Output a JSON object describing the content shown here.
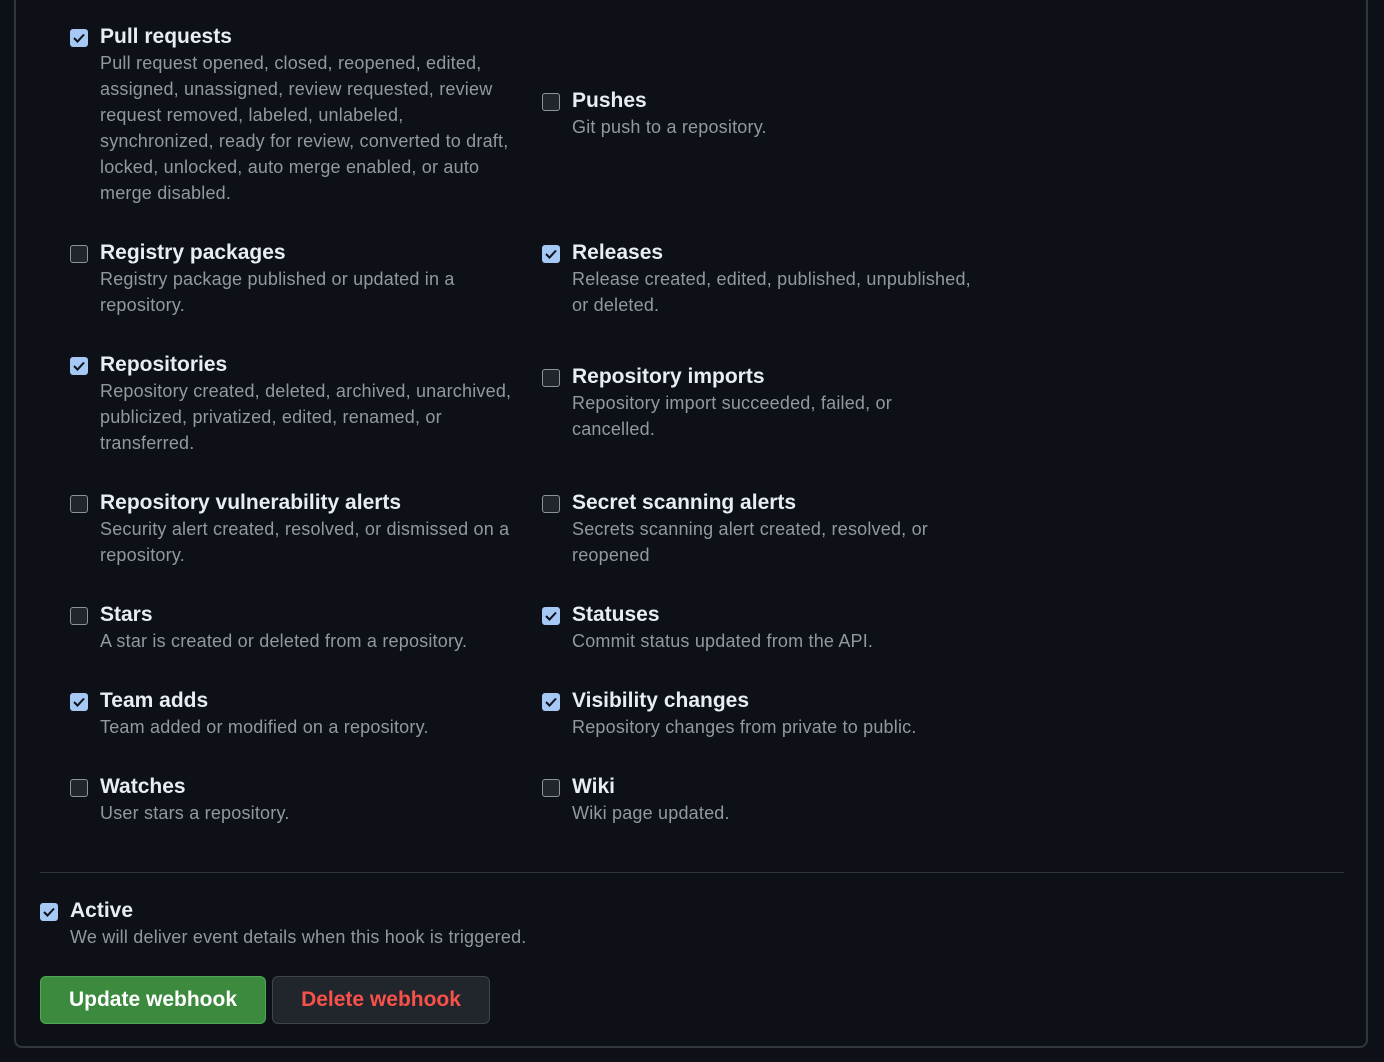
{
  "events": [
    {
      "id": "pull-requests",
      "title": "Pull requests",
      "checked": true,
      "description": "Pull request opened, closed, reopened, edited, assigned, unassigned, review requested, review request removed, labeled, unlabeled, synchronized, ready for review, converted to draft, locked, unlocked, auto merge enabled, or auto merge disabled."
    },
    {
      "id": "pushes",
      "title": "Pushes",
      "checked": false,
      "description": "Git push to a repository."
    },
    {
      "id": "registry-packages",
      "title": "Registry packages",
      "checked": false,
      "description": "Registry package published or updated in a repository."
    },
    {
      "id": "releases",
      "title": "Releases",
      "checked": true,
      "description": "Release created, edited, published, unpublished, or deleted."
    },
    {
      "id": "repositories",
      "title": "Repositories",
      "checked": true,
      "description": "Repository created, deleted, archived, unarchived, publicized, privatized, edited, renamed, or transferred."
    },
    {
      "id": "repository-imports",
      "title": "Repository imports",
      "checked": false,
      "description": "Repository import succeeded, failed, or cancelled."
    },
    {
      "id": "repository-vulnerability-alerts",
      "title": "Repository vulnerability alerts",
      "checked": false,
      "description": "Security alert created, resolved, or dismissed on a repository."
    },
    {
      "id": "secret-scanning-alerts",
      "title": "Secret scanning alerts",
      "checked": false,
      "description": "Secrets scanning alert created, resolved, or reopened"
    },
    {
      "id": "stars",
      "title": "Stars",
      "checked": false,
      "description": "A star is created or deleted from a repository."
    },
    {
      "id": "statuses",
      "title": "Statuses",
      "checked": true,
      "description": "Commit status updated from the API."
    },
    {
      "id": "team-adds",
      "title": "Team adds",
      "checked": true,
      "description": "Team added or modified on a repository."
    },
    {
      "id": "visibility-changes",
      "title": "Visibility changes",
      "checked": true,
      "description": "Repository changes from private to public."
    },
    {
      "id": "watches",
      "title": "Watches",
      "checked": false,
      "description": "User stars a repository."
    },
    {
      "id": "wiki",
      "title": "Wiki",
      "checked": false,
      "description": "Wiki page updated."
    }
  ],
  "active": {
    "title": "Active",
    "checked": true,
    "description": "We will deliver event details when this hook is triggered."
  },
  "buttons": {
    "update_label": "Update webhook",
    "delete_label": "Delete webhook"
  },
  "colors": {
    "background": "#0d1117",
    "checkbox_checked": "#a5c8f5",
    "update_button": "#3c8a3e",
    "delete_text": "#f85149"
  }
}
